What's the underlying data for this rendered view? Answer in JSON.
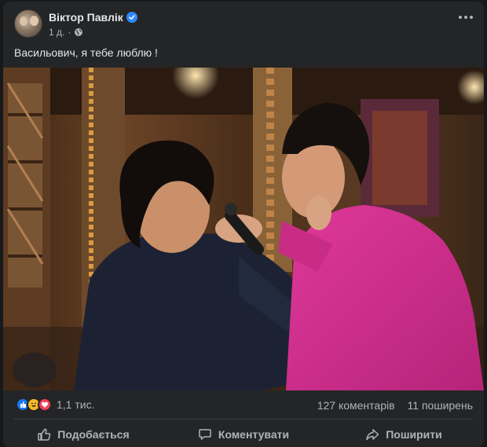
{
  "post": {
    "author": "Віктор Павлік",
    "time": "1 д.",
    "dot": "·",
    "caption": "Васильович, я тебе люблю !"
  },
  "stats": {
    "reactions_count": "1,1 тис.",
    "comments": "127 коментарів",
    "shares": "11 поширень"
  },
  "actions": {
    "like": "Подобається",
    "comment": "Коментувати",
    "share": "Поширити"
  },
  "icons": {
    "verified": "verified-badge-icon",
    "audience": "globe-icon",
    "menu": "more-horizontal-icon",
    "like": "thumbs-up-icon",
    "comment": "comment-bubble-icon",
    "share": "share-arrow-icon"
  },
  "colors": {
    "accent": "#2d88ff",
    "like_reaction": "#1877f2",
    "haha_reaction": "#f7b928",
    "love_reaction": "#f33e58"
  }
}
